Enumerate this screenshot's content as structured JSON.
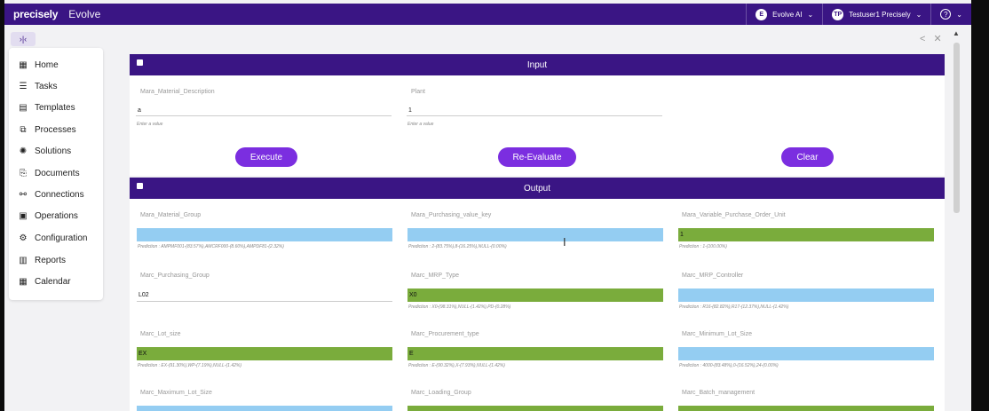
{
  "topbar": {
    "brand": "precisely",
    "app": "Evolve",
    "ai_avatar": "E",
    "ai_label": "Evolve AI",
    "user_avatar": "TP",
    "user_label": "Testuser1 Precisely",
    "help": "?"
  },
  "collapse": "›|‹",
  "sidebar": {
    "items": [
      {
        "label": "Home",
        "icon": "▦"
      },
      {
        "label": "Tasks",
        "icon": "☰"
      },
      {
        "label": "Templates",
        "icon": "▤"
      },
      {
        "label": "Processes",
        "icon": "⧉"
      },
      {
        "label": "Solutions",
        "icon": "✺"
      },
      {
        "label": "Documents",
        "icon": "⎘"
      },
      {
        "label": "Connections",
        "icon": "⚯"
      },
      {
        "label": "Operations",
        "icon": "▣"
      },
      {
        "label": "Configuration",
        "icon": "⚙"
      },
      {
        "label": "Reports",
        "icon": "▥"
      },
      {
        "label": "Calendar",
        "icon": "▦"
      }
    ]
  },
  "toolbar": {
    "share_icon": "<",
    "close_icon": "✕"
  },
  "input": {
    "title": "Input",
    "fields": [
      {
        "label": "Mara_Material_Description",
        "value": "a",
        "hint": "Enter a value"
      },
      {
        "label": "Plant",
        "value": "1",
        "hint": "Enter a value"
      }
    ],
    "buttons": {
      "execute": "Execute",
      "reevaluate": "Re-Evaluate",
      "clear": "Clear"
    }
  },
  "output": {
    "title": "Output",
    "fields": [
      {
        "label": "Mara_Material_Group",
        "value": "",
        "prediction": "Prediction : AMPMF001-(83.57%),AMCRF000-(8.60%),AMPDF81-(2.32%)",
        "color": "#94cdf2"
      },
      {
        "label": "Mara_Purchasing_value_key",
        "value": "",
        "prediction": "Prediction : 2-(83.75%),8-(16.25%),NULL-(0.00%)",
        "color": "#94cdf2"
      },
      {
        "label": "Mara_Variable_Purchase_Order_Unit",
        "value": "1",
        "prediction": "Prediction : 1-(100.00%)",
        "color": "#7aac3c"
      },
      {
        "label": "Marc_Purchasing_Group",
        "value": "L02",
        "prediction": "",
        "color": ""
      },
      {
        "label": "Marc_MRP_Type",
        "value": "X0",
        "prediction": "Prediction : X0-(98.31%),NULL-(1.42%),PD-(0.28%)",
        "color": "#7aac3c"
      },
      {
        "label": "Marc_MRP_Controller",
        "value": "",
        "prediction": "Prediction : R16-(82.82%),R17-(12.37%),NULL-(1.42%)",
        "color": "#94cdf2"
      },
      {
        "label": "Marc_Lot_size",
        "value": "EX",
        "prediction": "Prediction : EX-(91.30%),WP-(7.19%),NULL-(1.42%)",
        "color": "#7aac3c"
      },
      {
        "label": "Marc_Procurement_type",
        "value": "E",
        "prediction": "Prediction : E-(90.32%),X-(7.93%),NULL-(1.42%)",
        "color": "#7aac3c"
      },
      {
        "label": "Marc_Minimum_Lot_Size",
        "value": "",
        "prediction": "Prediction : 4000-(83.48%),0-(16.52%),24-(0.00%)",
        "color": "#94cdf2"
      },
      {
        "label": "Marc_Maximum_Lot_Size",
        "value": "",
        "prediction": "",
        "color": "#94cdf2"
      },
      {
        "label": "Marc_Loading_Group",
        "value": "",
        "prediction": "",
        "color": "#7aac3c"
      },
      {
        "label": "Marc_Batch_management",
        "value": "",
        "prediction": "",
        "color": "#7aac3c"
      }
    ]
  },
  "colors": {
    "header": "#3a1584",
    "button": "#7b2ee0",
    "match": "#7aac3c",
    "mismatch": "#94cdf2"
  }
}
